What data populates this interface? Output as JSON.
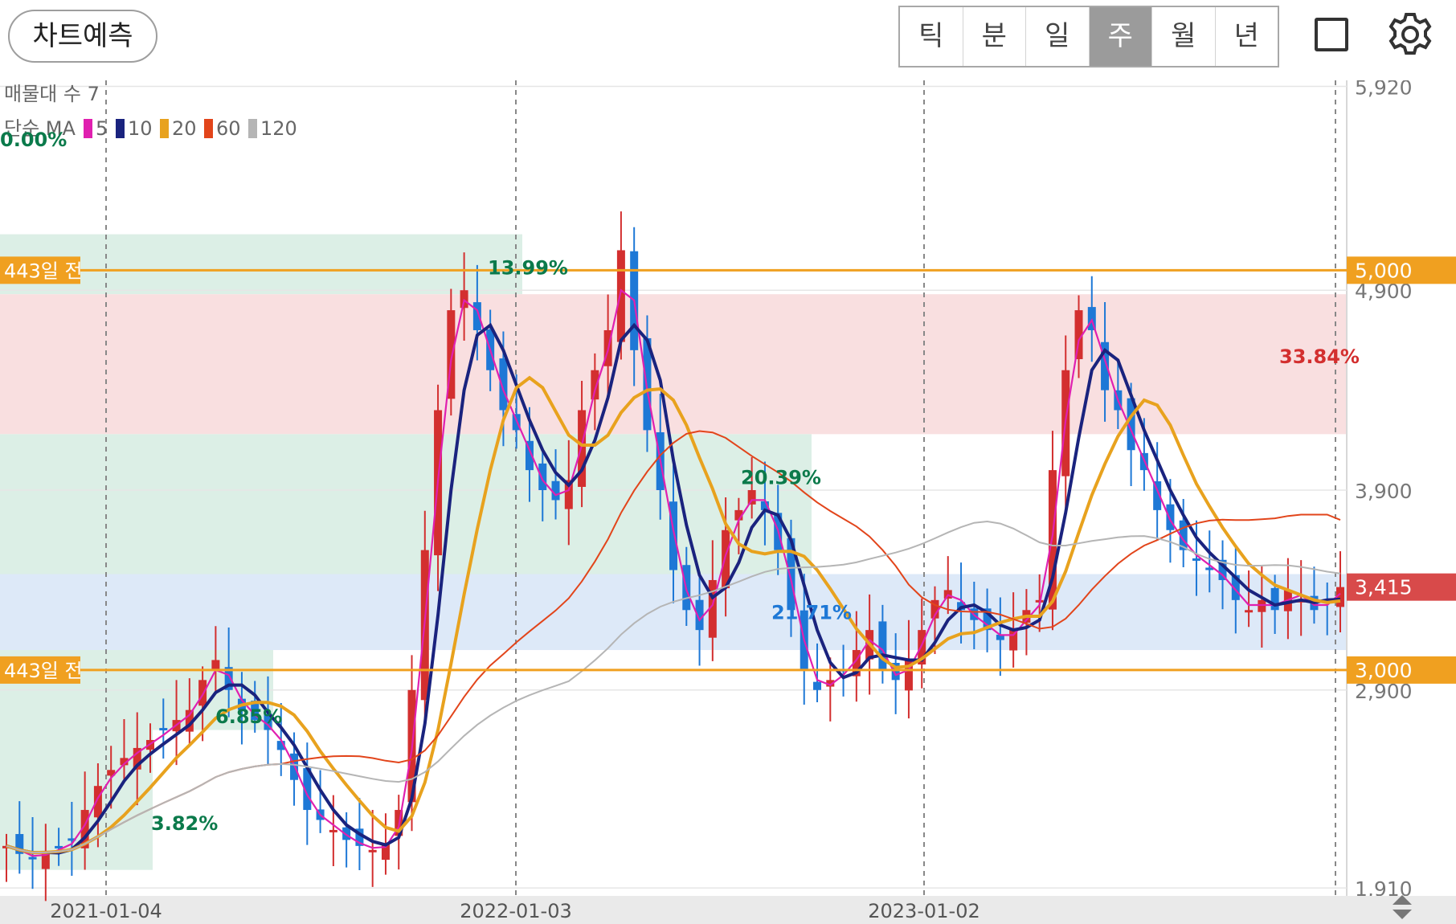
{
  "header": {
    "predict_label": "차트예측",
    "period_tabs": [
      {
        "label": "틱",
        "active": false
      },
      {
        "label": "분",
        "active": false
      },
      {
        "label": "일",
        "active": false
      },
      {
        "label": "주",
        "active": true
      },
      {
        "label": "월",
        "active": false
      },
      {
        "label": "년",
        "active": false
      }
    ]
  },
  "overlay_labels": {
    "volume_profile": "매물대 수 7",
    "ma_title": "단순 MA",
    "ma_periods": [
      "5",
      "10",
      "20",
      "60",
      "120"
    ],
    "hline_label": "443일 전",
    "zone_top_pct": "0.00%",
    "zone_pcts": [
      "13.99%",
      "33.84%",
      "20.39%",
      "21.71%",
      "6.85%",
      "3.82%"
    ]
  },
  "colors": {
    "up": "#d32f2f",
    "down": "#1e78d6",
    "ma5": "#e020b0",
    "ma10": "#1a237e",
    "ma20": "#e8a21e",
    "ma60": "#e2451b",
    "ma120": "#b5b5b5",
    "hline": "#f0a020",
    "price_tag": "#d84a4a",
    "zone_green": "#dcefe6",
    "zone_red": "#f9dfe0",
    "zone_blue": "#dde9f8"
  },
  "chart_data": {
    "type": "candlestick",
    "timeframe": "weekly",
    "x_ticks": [
      "2021-01-04",
      "2022-01-03",
      "2023-01-02"
    ],
    "y_ticks": [
      1910,
      2900,
      3900,
      4900,
      5920
    ],
    "ylim": [
      1850,
      5950
    ],
    "last_price": 3415,
    "horizontal_lines": [
      {
        "value": 5000,
        "label": "443일 전",
        "tag": "5,000"
      },
      {
        "value": 3000,
        "label": "443일 전",
        "tag": "3,000"
      }
    ],
    "price_tag": "3,415",
    "series": [
      {
        "name": "5",
        "type": "ma"
      },
      {
        "name": "10",
        "type": "ma"
      },
      {
        "name": "20",
        "type": "ma"
      },
      {
        "name": "60",
        "type": "ma"
      },
      {
        "name": "120",
        "type": "ma"
      }
    ],
    "close_path": [
      2120,
      2080,
      2060,
      2090,
      2110,
      2150,
      2300,
      2420,
      2500,
      2560,
      2610,
      2650,
      2700,
      2750,
      2800,
      2950,
      3050,
      2900,
      2800,
      2750,
      2700,
      2600,
      2450,
      2300,
      2250,
      2200,
      2150,
      2120,
      2100,
      2130,
      2300,
      2900,
      3600,
      4300,
      4800,
      4900,
      4700,
      4500,
      4300,
      4200,
      4000,
      3900,
      3850,
      3950,
      4300,
      4500,
      4700,
      5100,
      4600,
      4200,
      3900,
      3500,
      3300,
      3200,
      3450,
      3700,
      3800,
      3900,
      3800,
      3600,
      3300,
      3000,
      2900,
      2950,
      3000,
      3100,
      3200,
      3000,
      2950,
      3050,
      3200,
      3350,
      3400,
      3300,
      3250,
      3200,
      3150,
      3200,
      3300,
      3350,
      4000,
      4500,
      4800,
      4700,
      4400,
      4300,
      4100,
      4000,
      3800,
      3700,
      3600,
      3550,
      3500,
      3450,
      3350,
      3300,
      3350,
      3300,
      3400,
      3350,
      3300,
      3350,
      3415
    ]
  }
}
